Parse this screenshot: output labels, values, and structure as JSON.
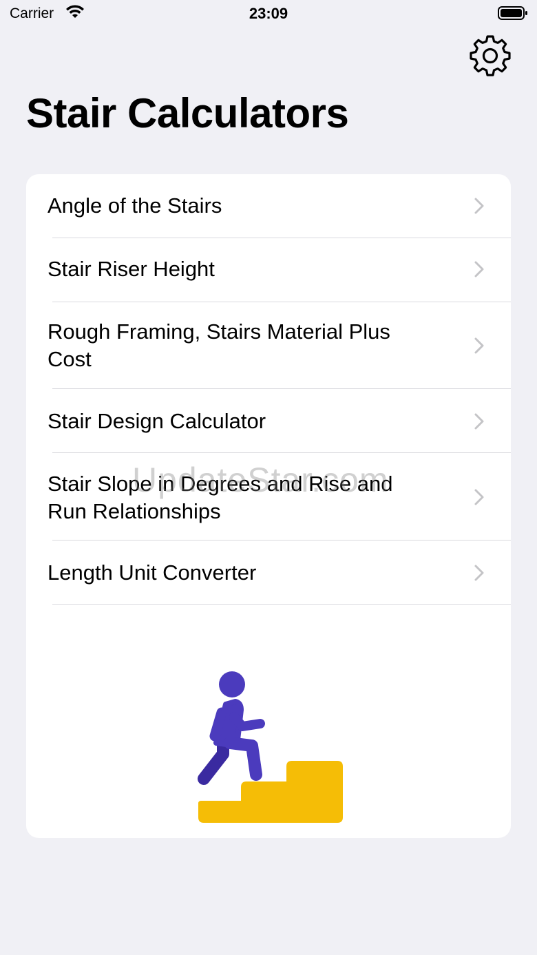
{
  "status_bar": {
    "carrier": "Carrier",
    "time": "23:09"
  },
  "header": {
    "title": "Stair Calculators",
    "settings_icon": "gear-icon"
  },
  "menu": {
    "items": [
      {
        "label": "Angle of the Stairs"
      },
      {
        "label": "Stair Riser Height"
      },
      {
        "label": "Rough Framing, Stairs Material Plus Cost"
      },
      {
        "label": "Stair Design Calculator"
      },
      {
        "label": "Stair Slope in Degrees and Rise and Run Relationships"
      },
      {
        "label": "Length Unit Converter"
      }
    ]
  },
  "watermark": "UpdateStar.com",
  "colors": {
    "background": "#f0f0f5",
    "card": "#ffffff",
    "figure": "#4b3bbd",
    "stairs": "#f5bd06",
    "chevron": "#c4c4c7"
  }
}
